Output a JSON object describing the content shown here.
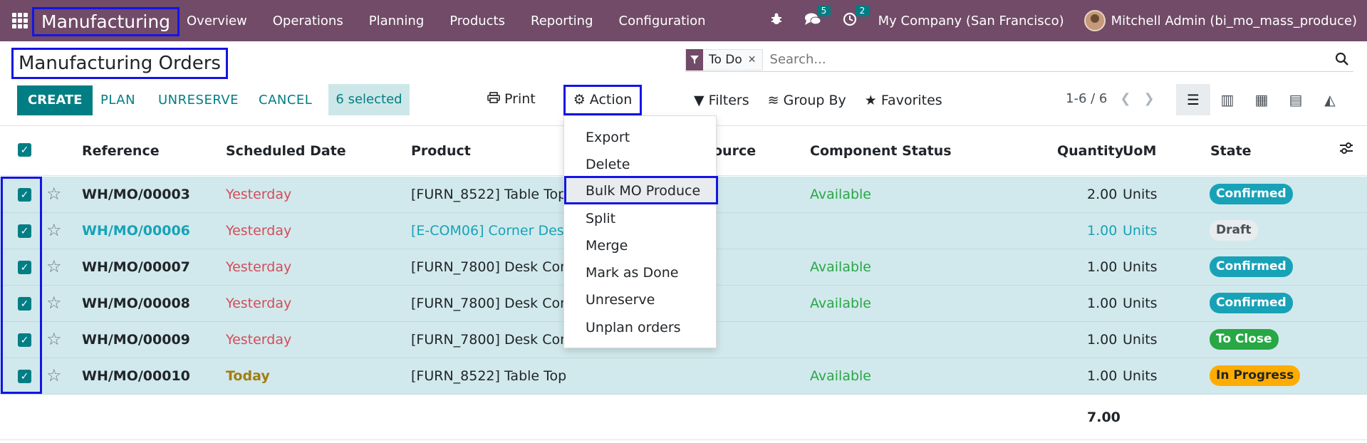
{
  "navbar": {
    "app_name": "Manufacturing",
    "menu": [
      "Overview",
      "Operations",
      "Planning",
      "Products",
      "Reporting",
      "Configuration"
    ],
    "messages_count": "5",
    "activities_count": "2",
    "company": "My Company (San Francisco)",
    "user": "Mitchell Admin (bi_mo_mass_produce)"
  },
  "page": {
    "title": "Manufacturing Orders"
  },
  "search": {
    "facet": "To Do",
    "placeholder": "Search..."
  },
  "buttons": {
    "create": "CREATE",
    "plan": "PLAN",
    "unreserve": "UNRESERVE",
    "cancel": "CANCEL",
    "selected": "6 selected",
    "print": "Print",
    "action": "Action"
  },
  "filters": {
    "filters": "Filters",
    "group_by": "Group By",
    "favorites": "Favorites"
  },
  "pager": {
    "range": "1-6 / 6"
  },
  "table": {
    "headers": {
      "reference": "Reference",
      "scheduled_date": "Scheduled Date",
      "product": "Product",
      "source": "ource",
      "component_status": "Component Status",
      "quantity": "Quantity",
      "uom": "UoM",
      "state": "State"
    },
    "rows": [
      {
        "ref": "WH/MO/00003",
        "date": "Yesterday",
        "product": "[FURN_8522] Table Top",
        "status": "Available",
        "qty": "2.00",
        "uom": "Units",
        "state": "Confirmed"
      },
      {
        "ref": "WH/MO/00006",
        "date": "Yesterday",
        "product": "[E-COM06] Corner Desk",
        "status": "",
        "qty": "1.00",
        "uom": "Units",
        "state": "Draft"
      },
      {
        "ref": "WH/MO/00007",
        "date": "Yesterday",
        "product": "[FURN_7800] Desk Comb",
        "status": "Available",
        "qty": "1.00",
        "uom": "Units",
        "state": "Confirmed"
      },
      {
        "ref": "WH/MO/00008",
        "date": "Yesterday",
        "product": "[FURN_7800] Desk Comb",
        "status": "Available",
        "qty": "1.00",
        "uom": "Units",
        "state": "Confirmed"
      },
      {
        "ref": "WH/MO/00009",
        "date": "Yesterday",
        "product": "[FURN_7800] Desk Comb",
        "status": "",
        "qty": "1.00",
        "uom": "Units",
        "state": "To Close"
      },
      {
        "ref": "WH/MO/00010",
        "date": "Today",
        "product": "[FURN_8522] Table Top",
        "status": "Available",
        "qty": "1.00",
        "uom": "Units",
        "state": "In Progress"
      }
    ],
    "total_quantity": "7.00"
  },
  "action_menu": {
    "items": [
      "Export",
      "Delete",
      "Bulk MO Produce",
      "Split",
      "Merge",
      "Mark as Done",
      "Unreserve",
      "Unplan orders"
    ]
  },
  "colors": {
    "navbar": "#714b67",
    "primary": "#017e84",
    "row_selected": "#d1e9ec",
    "overdue": "#d44c59",
    "today": "#a27d10",
    "available": "#28a745",
    "highlight_border": "#1414e6",
    "confirmed": "#17a2b8",
    "to_close": "#28a745",
    "in_progress": "#ffac00"
  }
}
